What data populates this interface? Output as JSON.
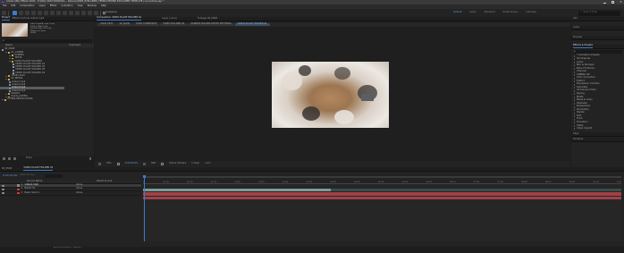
{
  "titlebar": {
    "app_badge": "Ae",
    "title": "Adobe After Effects 2020 - D:\\ktk\\I 2020 WORK\\Wo... Delivery\\MINI_EXPLAINER_TEMPLATE\\MINI EXPLAINER TEMPLATE (converted).aep *"
  },
  "menu": [
    "File",
    "Edit",
    "Composition",
    "Layer",
    "Effect",
    "Animation",
    "View",
    "Window",
    "Help"
  ],
  "toolbar": {
    "snapping": "Snapping",
    "workspaces": [
      "Default",
      "Learn",
      "Standard",
      "Small Screen",
      "Libraries"
    ],
    "active_workspace": "Default",
    "search_placeholder": "Search Help"
  },
  "project_panel": {
    "tab_project": "Project",
    "tab_effect_controls": "Effect Controls video1.mp4",
    "selected_file": "video1.mp4",
    "file_info": [
      "video1.mp4 ▼, used 1 time",
      "1920 x 1080 (1.00)",
      "Δ 0;00;10;00, 29.97 fps",
      "Millions of Colors",
      "H.264"
    ],
    "search_placeholder": "ρ",
    "col_name": "Name",
    "col_comment": "Comment",
    "items": [
      {
        "label": "00_MAIN",
        "kind": "comp",
        "indent": 0
      },
      {
        "label": "01_COMPS",
        "kind": "folder",
        "indent": 1
      },
      {
        "label": "SCENES",
        "kind": "folder",
        "indent": 2
      },
      {
        "label": "TEXTS",
        "kind": "folder",
        "indent": 2
      },
      {
        "label": "VIDEO PLACE HOLDERS",
        "kind": "folder",
        "indent": 2
      },
      {
        "label": "VIDEO PLACE HOLDER 01",
        "kind": "comp",
        "indent": 3
      },
      {
        "label": "VIDEO PLACE HOLDER 02",
        "kind": "comp",
        "indent": 3
      },
      {
        "label": "VIDEO PLACE HOLDER 03",
        "kind": "comp",
        "indent": 3
      },
      {
        "label": "VIDEO PLACE HOLDER 04",
        "kind": "comp",
        "indent": 3
      },
      {
        "label": "YOUR LOGO",
        "kind": "folder",
        "indent": 1
      },
      {
        "label": "02_MEDIA",
        "kind": "folder",
        "indent": 1
      },
      {
        "label": "video1.mp4",
        "kind": "video",
        "indent": 2
      },
      {
        "label": "video2.mp4",
        "kind": "video",
        "indent": 2
      },
      {
        "label": "video3.mp4",
        "kind": "video",
        "indent": 2,
        "selected": true
      },
      {
        "label": "video4.mp4",
        "kind": "video",
        "indent": 2
      },
      {
        "label": "SOLIDS",
        "kind": "folder",
        "indent": 1
      },
      {
        "label": "Solids_COMPS",
        "kind": "folder",
        "indent": 1
      },
      {
        "label": "OTHER RESOLUTIONS",
        "kind": "folder",
        "indent": 0
      }
    ],
    "bpc": "8 bpc"
  },
  "comp_panel": {
    "tab_comp": "Composition VIDEO PLACE HOLDER 01",
    "tab_layer": "Layer (none)",
    "tab_footage": "Footage 00_MAIN",
    "breadcrumbs": [
      "YOUR TEXT",
      "00_MAIN",
      "YOUR COMPOSITE",
      "VIDEO HOLDER 02",
      "SCREEN HOLDER DRYER SETTINGS",
      "VIDEO PLACE HOLDER 01"
    ],
    "zoom": "33%",
    "timecode": "0;00;00;00",
    "resolution": "Half",
    "camera": "Active Camera",
    "view": "1 View",
    "offset": "+0.0"
  },
  "right_panel": {
    "sections": [
      "Info",
      "Audio",
      "Preview",
      "Effects & Presets"
    ],
    "search_placeholder": "ρ",
    "effects": [
      "* Animation Presets",
      "3D Channel",
      "Audio",
      "Blur & Sharpen",
      "Boris FX Mocha",
      "Channel",
      "CINEMA 4D",
      "Color Correction",
      "Distort",
      "Expression Controls",
      "Generate",
      "Immersive Video",
      "Keying",
      "Matte",
      "Noise & Grain",
      "Obsolete",
      "Perspective",
      "Simulation",
      "Stylize",
      "Text",
      "Time",
      "Transition",
      "Utility",
      "Video Copilot"
    ],
    "bottom_sections": [
      "Align",
      "Libraries"
    ]
  },
  "timeline": {
    "tabs": [
      "00_MAIN",
      "VIDEO PLACE HOLDER 01"
    ],
    "timecode": "0;00;00;00",
    "timecode_sub": "00000 (29.97 fps)",
    "col_source": "Source Name",
    "col_parent": "Parent & Link",
    "ruler": [
      "0f",
      "00:15f",
      "01:00f",
      "01:15f",
      "02:00f",
      "02:15f",
      "03:00f",
      "03:15f",
      "04:00f",
      "04:15f",
      "05:00f",
      "05:15f",
      "06:00f",
      "06:15f",
      "07:00f",
      "07:15f",
      "08:00f",
      "08:15f",
      "09:00f",
      "09:15f",
      "10:0"
    ],
    "layers": [
      {
        "num": "1",
        "name": "video1.mp4",
        "label": "#8a8a8a",
        "parent": "None",
        "selected": true
      },
      {
        "num": "2",
        "name": "BASIC S1",
        "label": "#c63a3a",
        "parent": "None",
        "selected": false
      },
      {
        "num": "3",
        "name": "Basic Solid 1",
        "label": "#c63a3a",
        "parent": "None",
        "selected": false
      }
    ],
    "footer": "Toggle Switches / Modes",
    "colors": {
      "video_track": "#7e9a98",
      "solid_track": "#a04246",
      "accent": "#3b7bd1"
    }
  }
}
